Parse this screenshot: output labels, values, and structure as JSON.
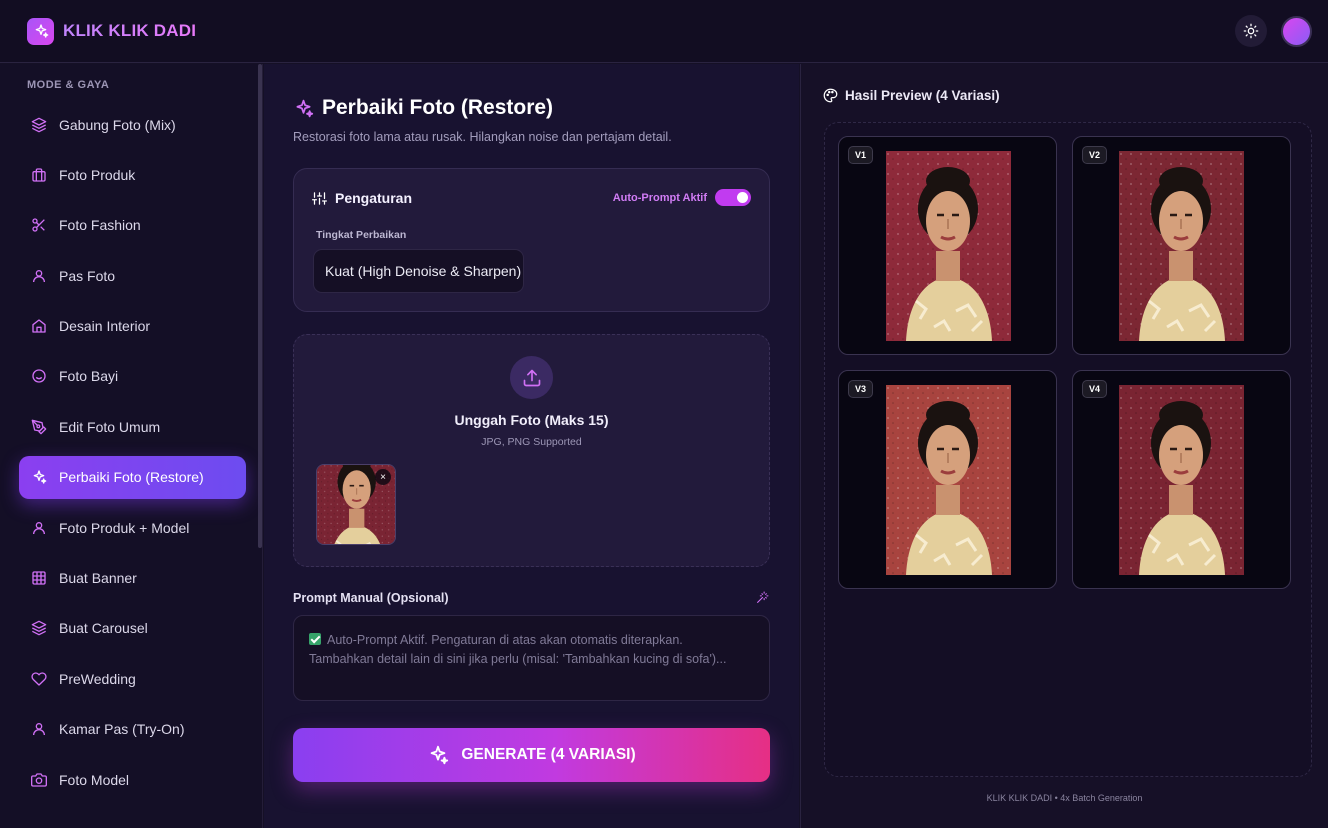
{
  "app": {
    "name": "KLIK KLIK DADI"
  },
  "header": {
    "theme_icon": "sun-icon",
    "avatar_color": "#d946ef"
  },
  "sidebar": {
    "heading": "MODE & GAYA",
    "items": [
      {
        "label": "Gabung Foto (Mix)",
        "icon": "layers-icon"
      },
      {
        "label": "Foto Produk",
        "icon": "briefcase-icon"
      },
      {
        "label": "Foto Fashion",
        "icon": "scissors-icon"
      },
      {
        "label": "Pas Foto",
        "icon": "user-icon"
      },
      {
        "label": "Desain Interior",
        "icon": "home-icon"
      },
      {
        "label": "Foto Bayi",
        "icon": "smile-icon"
      },
      {
        "label": "Edit Foto Umum",
        "icon": "pen-tool-icon"
      },
      {
        "label": "Perbaiki Foto (Restore)",
        "icon": "sparkles-icon",
        "active": true
      },
      {
        "label": "Foto Produk + Model",
        "icon": "user-icon"
      },
      {
        "label": "Buat Banner",
        "icon": "grid-icon"
      },
      {
        "label": "Buat Carousel",
        "icon": "layers-icon"
      },
      {
        "label": "PreWedding",
        "icon": "heart-icon"
      },
      {
        "label": "Kamar Pas (Try-On)",
        "icon": "user-icon"
      },
      {
        "label": "Foto Model",
        "icon": "camera-icon"
      }
    ]
  },
  "main": {
    "title": "Perbaiki Foto (Restore)",
    "subtitle": "Restorasi foto lama atau rusak. Hilangkan noise dan pertajam detail.",
    "settings": {
      "title": "Pengaturan",
      "auto_prompt_label": "Auto-Prompt Aktif",
      "auto_prompt_on": true,
      "field_label": "Tingkat Perbaikan",
      "field_value": "Kuat (High Denoise & Sharpen)"
    },
    "upload": {
      "title": "Unggah Foto (Maks 15)",
      "subtitle": "JPG, PNG Supported",
      "remove_label": "×"
    },
    "prompt": {
      "label": "Prompt Manual (Opsional)",
      "line1": "Auto-Prompt Aktif. Pengaturan di atas akan otomatis diterapkan.",
      "line2": "Tambahkan detail lain di sini jika perlu (misal: 'Tambahkan kucing di sofa')..."
    },
    "generate_label": "GENERATE (4 VARIASI)"
  },
  "preview": {
    "title": "Hasil Preview (4 Variasi)",
    "variants": [
      {
        "badge": "V1"
      },
      {
        "badge": "V2"
      },
      {
        "badge": "V3"
      },
      {
        "badge": "V4"
      }
    ],
    "footer": "KLIK KLIK DADI • 4x Batch Generation"
  },
  "colors": {
    "accent": "#8b3ff0",
    "accent_pink": "#e62f84",
    "background": "#151026"
  }
}
